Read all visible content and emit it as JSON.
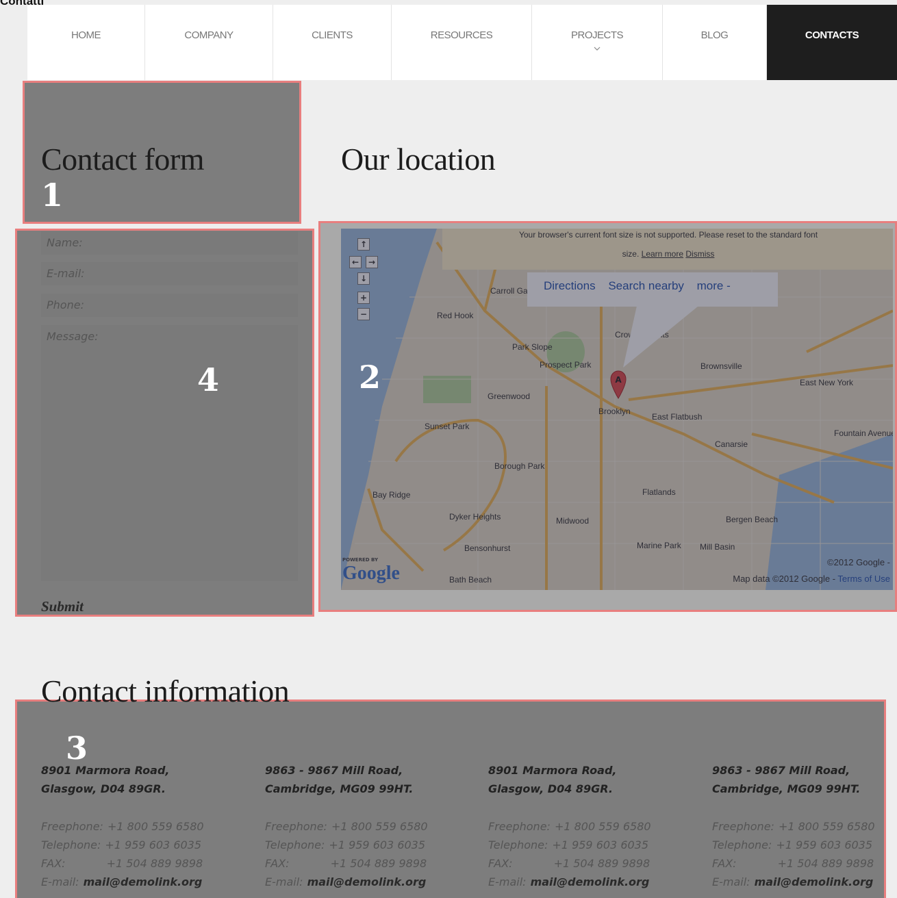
{
  "page_label": "Contatti",
  "nav": {
    "items": [
      "HOME",
      "COMPANY",
      "CLIENTS",
      "RESOURCES",
      "PROJECTS",
      "BLOG",
      "CONTACTS"
    ]
  },
  "headings": {
    "contact_form": "Contact form",
    "location": "Our location",
    "contact_info": "Contact information"
  },
  "annotations": [
    "1",
    "2",
    "3",
    "4"
  ],
  "form": {
    "name_placeholder": "Name:",
    "email_placeholder": "E-mail:",
    "phone_placeholder": "Phone:",
    "message_placeholder": "Message:",
    "submit_label": "Submit"
  },
  "map": {
    "notice_text": "Your browser's current font size is not supported. Please reset to the standard font",
    "notice_size": "size.",
    "notice_learn": "Learn more",
    "notice_dismiss": "Dismiss",
    "bubble": {
      "directions": "Directions",
      "search": "Search nearby",
      "more": "more -"
    },
    "places": [
      "Carroll Gardens",
      "Red Hook",
      "Park Slope",
      "Prospect Park",
      "Crown Heights",
      "Brownsville",
      "East New York",
      "Greenwood",
      "Brooklyn",
      "East Flatbush",
      "Sunset Park",
      "Canarsie",
      "Borough Park",
      "Bay Ridge",
      "Flatlands",
      "Dyker Heights",
      "Midwood",
      "Bensonhurst",
      "Marine Park",
      "Mill Basin",
      "Bergen Beach",
      "Bath Beach",
      "Fountain Avenue"
    ],
    "marker": "A",
    "copyright": "©2012 Google -",
    "attribution": "Map data ©2012 Google - ",
    "terms": "Terms of Use",
    "logo": "Google",
    "powered": "POWERED BY"
  },
  "contacts": [
    {
      "addr1": "8901 Marmora Road,",
      "addr2": "Glasgow, D04 89GR.",
      "free": "+1 800 559 6580",
      "tel": "+1 959 603 6035",
      "fax": "+1 504 889 9898",
      "email": "mail@demolink.org"
    },
    {
      "addr1": "9863 - 9867 Mill Road,",
      "addr2": "Cambridge, MG09 99HT.",
      "free": "+1 800 559 6580",
      "tel": "+1 959 603 6035",
      "fax": "+1 504 889 9898",
      "email": "mail@demolink.org"
    },
    {
      "addr1": "8901 Marmora Road,",
      "addr2": "Glasgow, D04 89GR.",
      "free": "+1 800 559 6580",
      "tel": "+1 959 603 6035",
      "fax": "+1 504 889 9898",
      "email": "mail@demolink.org"
    },
    {
      "addr1": "9863 - 9867 Mill Road,",
      "addr2": "Cambridge, MG09 99HT.",
      "free": "+1 800 559 6580",
      "tel": "+1 959 603 6035",
      "fax": "+1 504 889 9898",
      "email": "mail@demolink.org"
    }
  ],
  "contact_labels": {
    "free": "Freephone:",
    "tel": "Telephone:",
    "fax": "FAX:",
    "email": "E-mail:"
  }
}
